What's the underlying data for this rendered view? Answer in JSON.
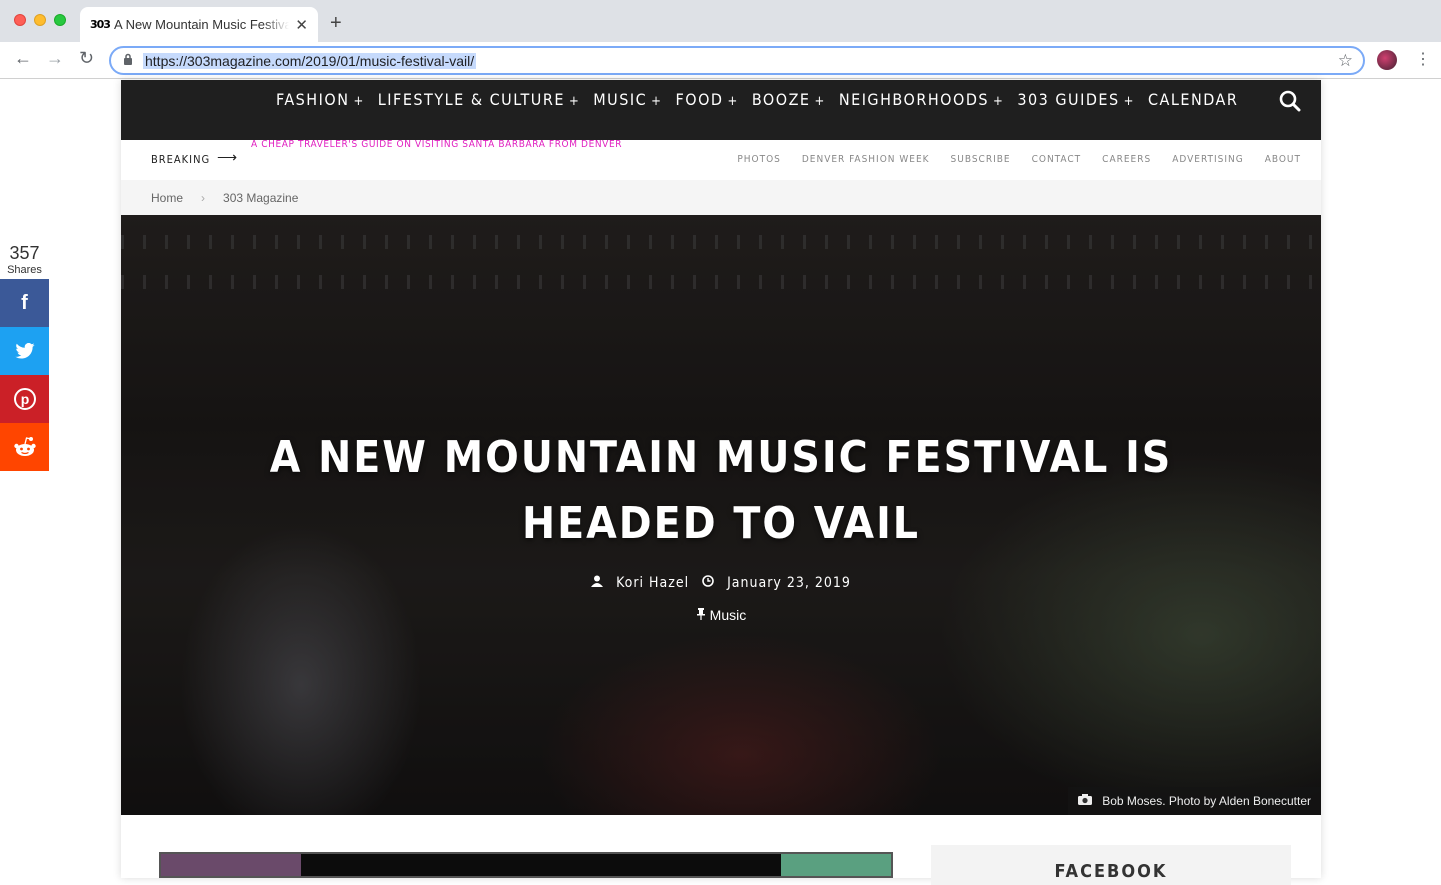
{
  "browser": {
    "tab_title": "A New Mountain Music Festival",
    "tab_favicon": "303",
    "url": "https://303magazine.com/2019/01/music-festival-vail/",
    "icons": [
      "back-icon",
      "forward-icon",
      "reload-icon",
      "lock-icon",
      "star-icon",
      "menu-icon"
    ]
  },
  "main_nav": {
    "items": [
      {
        "label": "FASHION",
        "has_submenu": true
      },
      {
        "label": "LIFESTYLE & CULTURE",
        "has_submenu": true
      },
      {
        "label": "MUSIC",
        "has_submenu": true
      },
      {
        "label": "FOOD",
        "has_submenu": true
      },
      {
        "label": "BOOZE",
        "has_submenu": true
      },
      {
        "label": "NEIGHBORHOODS",
        "has_submenu": true
      },
      {
        "label": "303 GUIDES",
        "has_submenu": true
      },
      {
        "label": "CALENDAR",
        "has_submenu": false
      }
    ],
    "plus": "+"
  },
  "breaking": {
    "label": "BREAKING",
    "arrow": "⟶",
    "headline": "A CHEAP TRAVELER'S GUIDE ON VISITING SANTA BARBARA FROM DENVER"
  },
  "secondary_nav": {
    "items": [
      "PHOTOS",
      "DENVER FASHION WEEK",
      "SUBSCRIBE",
      "CONTACT",
      "CAREERS",
      "ADVERTISING",
      "ABOUT"
    ]
  },
  "breadcrumb": {
    "home": "Home",
    "sep": "›",
    "current": "303 Magazine"
  },
  "article": {
    "title": "A NEW MOUNTAIN MUSIC FESTIVAL IS HEADED TO VAIL",
    "author": "Kori Hazel",
    "date": "January 23, 2019",
    "category": "Music",
    "photo_caption": "Bob Moses. Photo by Alden Bonecutter"
  },
  "sidebar": {
    "title": "FACEBOOK"
  },
  "share": {
    "count": "357",
    "label": "Shares"
  }
}
